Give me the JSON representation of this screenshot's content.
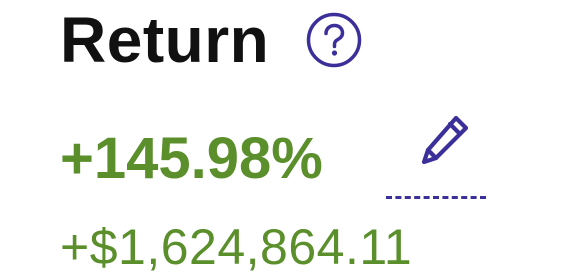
{
  "header": {
    "title": "Return",
    "help_icon": "question-circle-icon"
  },
  "return": {
    "percent": "+145.98%",
    "amount": "+$1,624,864.11",
    "edit_icon": "pencil-icon"
  },
  "colors": {
    "title": "#111111",
    "positive": "#5a8f2b",
    "accent": "#3b2f9a"
  }
}
